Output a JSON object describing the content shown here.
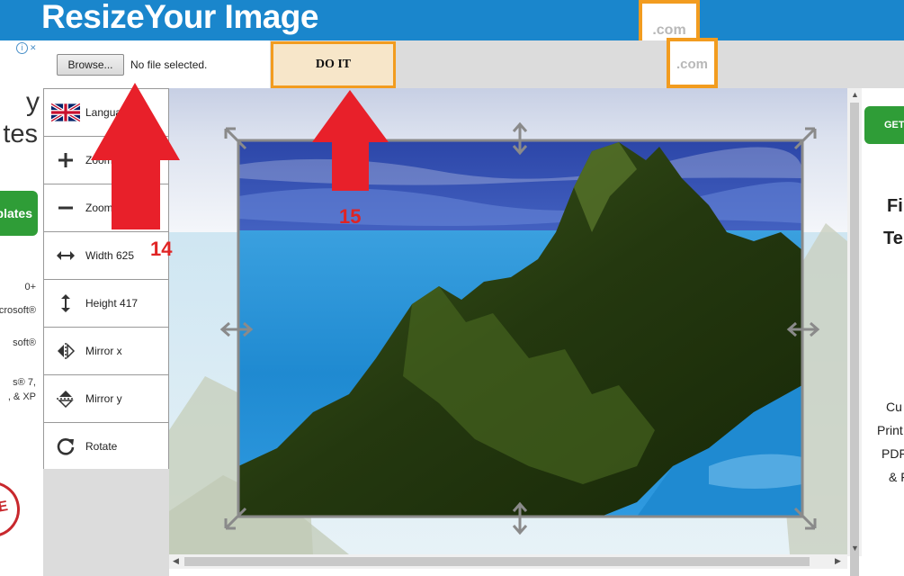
{
  "header": {
    "logo": "ResizeYour Image",
    "badge_primary": ".com",
    "badge_secondary": ".com"
  },
  "toolbar": {
    "browse_label": "Browse...",
    "file_status": "No file selected.",
    "doit_label": "DO IT"
  },
  "left_ad": {
    "adchoices_icon": "i",
    "adchoices_close": "✕",
    "line1": "y",
    "line2": "tes",
    "button_label": "plates",
    "small_lines": [
      "0+",
      "icrosoft®",
      "soft®",
      "s® 7,",
      ", & XP"
    ],
    "seal_text": "TE"
  },
  "sidebar": {
    "items": [
      {
        "label": "Langua",
        "icon": "uk-flag-icon"
      },
      {
        "label": "Zoom",
        "icon": "plus-icon"
      },
      {
        "label": "Zoom",
        "icon": "minus-icon"
      },
      {
        "label": "Width 625",
        "icon": "horizontal-arrows-icon"
      },
      {
        "label": "Height 417",
        "icon": "vertical-arrows-icon"
      },
      {
        "label": "Mirror x",
        "icon": "mirror-x-icon"
      },
      {
        "label": "Mirror y",
        "icon": "mirror-y-icon"
      },
      {
        "label": "Rotate",
        "icon": "rotate-icon"
      }
    ]
  },
  "annotations": {
    "arrow_14_label": "14",
    "arrow_15_label": "15",
    "arrow_color": "#e8202a"
  },
  "right_ad": {
    "button_label": "GET",
    "heading1": "Fi",
    "heading2": "Te",
    "lines": [
      "Cu",
      "Print",
      "PDF",
      "& F"
    ]
  },
  "colors": {
    "header_blue": "#1a86cc",
    "accent_orange": "#f29c1f",
    "doit_fill": "#f7e6c9",
    "ad_green": "#2f9d37"
  }
}
